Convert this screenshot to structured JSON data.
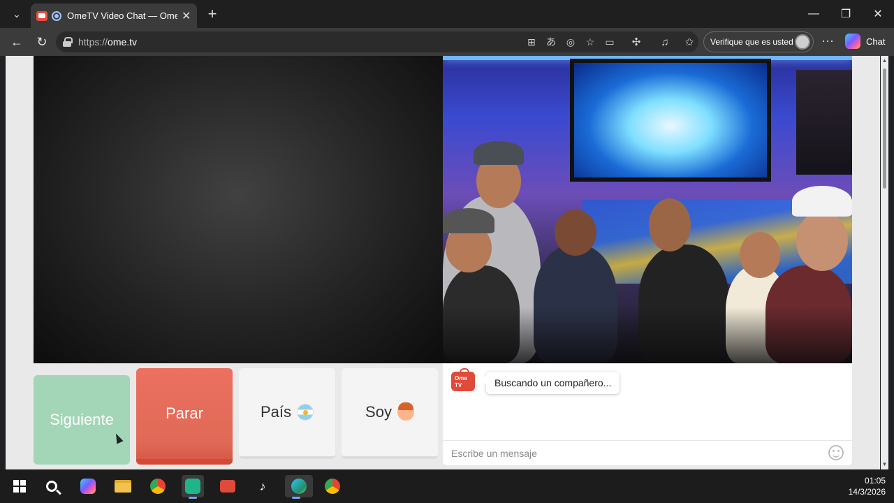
{
  "browser": {
    "tab_title": "OmeTV Video Chat — Omegle",
    "url_scheme": "https://",
    "url_host": "ome.tv",
    "verify_label": "Verifique que es usted",
    "copilot_label": "Chat"
  },
  "icons": {
    "tab_menu": "chevron-down-icon",
    "new_tab": "plus-icon",
    "minimize": "minimize-icon",
    "restore": "restore-icon",
    "close": "close-icon",
    "back": "back-arrow-icon",
    "reload": "reload-icon",
    "lock": "lock-icon",
    "favorite": "star-icon",
    "more": "ellipsis-icon"
  },
  "controls": {
    "next_label": "Siguiente",
    "stop_label": "Parar",
    "country_label": "País",
    "gender_label": "Soy"
  },
  "chat": {
    "status_message": "Buscando un compañero...",
    "input_placeholder": "Escribe un mensaje",
    "logo_text_top": "Ome",
    "logo_text_bottom": "TV"
  },
  "taskbar": {
    "time": "01:05",
    "date": "14/3/2026"
  },
  "colors": {
    "next_button": "#a2d6b6",
    "stop_button": "#e06a57",
    "brand_red": "#e04a3a"
  }
}
